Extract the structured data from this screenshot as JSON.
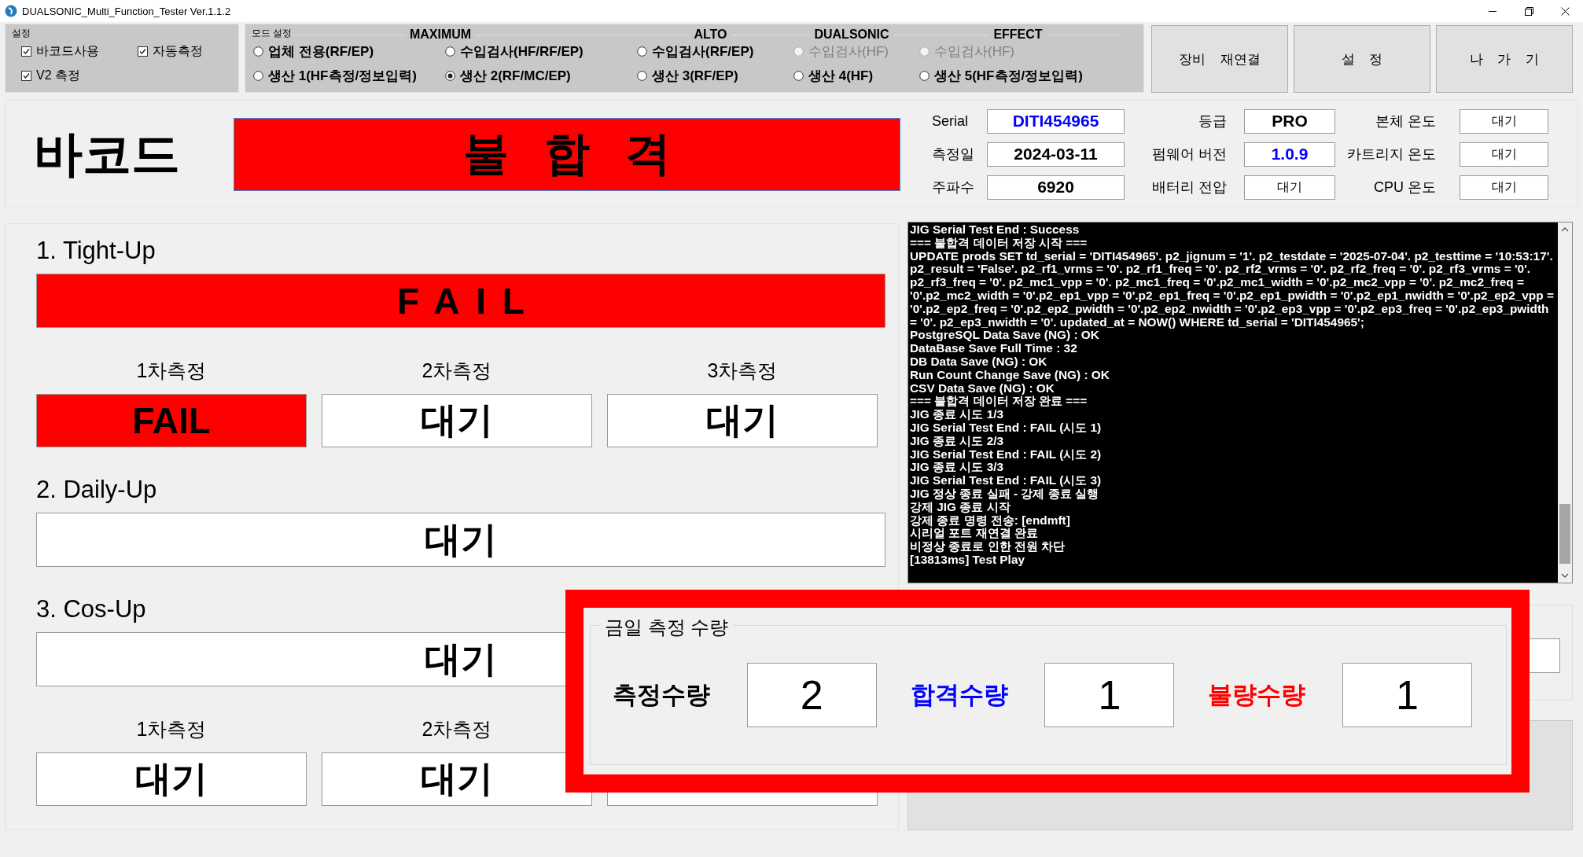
{
  "window": {
    "title": "DUALSONIC_Multi_Function_Tester Ver.1.1.2"
  },
  "settings": {
    "title": "설정",
    "checkboxes": [
      {
        "label": "바코드사용",
        "checked": true
      },
      {
        "label": "자동측정",
        "checked": true
      },
      {
        "label": "V2 측정",
        "checked": true
      }
    ]
  },
  "mode": {
    "title": "모드 설정",
    "groups": [
      {
        "title": "MAXIMUM",
        "columns": [
          [
            {
              "label": "업체 전용(RF/EP)",
              "selected": false,
              "disabled": false
            },
            {
              "label": "생산 1(HF측정/정보입력)",
              "selected": false,
              "disabled": false
            }
          ],
          [
            {
              "label": "수입검사(HF/RF/EP)",
              "selected": false,
              "disabled": false
            },
            {
              "label": "생산 2(RF/MC/EP)",
              "selected": true,
              "disabled": false
            }
          ]
        ]
      },
      {
        "title": "ALTO",
        "columns": [
          [
            {
              "label": "수입검사(RF/EP)",
              "selected": false,
              "disabled": false
            },
            {
              "label": "생산 3(RF/EP)",
              "selected": false,
              "disabled": false
            }
          ]
        ]
      },
      {
        "title": "DUALSONIC",
        "columns": [
          [
            {
              "label": "수입검사(HF)",
              "selected": false,
              "disabled": true
            },
            {
              "label": "생산 4(HF)",
              "selected": false,
              "disabled": false
            }
          ]
        ]
      },
      {
        "title": "EFFECT",
        "columns": [
          [
            {
              "label": "수입검사(HF)",
              "selected": false,
              "disabled": true
            },
            {
              "label": "생산 5(HF측정/정보입력)",
              "selected": false,
              "disabled": false
            }
          ]
        ]
      }
    ]
  },
  "buttons": [
    "장비 재연결",
    "설 정",
    "나 가 기"
  ],
  "barcode": {
    "label": "바코드",
    "result": "불 합 격",
    "failed": true
  },
  "info": [
    {
      "label": "Serial",
      "value": "DITI454965",
      "color": "#0000ff"
    },
    {
      "label": "등급",
      "value": "PRO",
      "color": "#000000"
    },
    {
      "label": "본체 온도",
      "value": "대기",
      "color": "#000000"
    },
    {
      "label": "측정일",
      "value": "2024-03-11",
      "color": "#000000"
    },
    {
      "label": "펌웨어 버전",
      "value": "1.0.9",
      "color": "#0000ff"
    },
    {
      "label": "카트리지 온도",
      "value": "대기",
      "color": "#000000"
    },
    {
      "label": "주파수",
      "value": "6920",
      "color": "#000000"
    },
    {
      "label": "배터리 전압",
      "value": "대기",
      "color": "#000000"
    },
    {
      "label": "CPU 온도",
      "value": "대기",
      "color": "#000000"
    }
  ],
  "tests": [
    {
      "title": "1. Tight-Up",
      "result": {
        "text": "FAIL",
        "failed": true
      },
      "rounds": [
        {
          "label": "1차측정",
          "text": "FAIL",
          "failed": true
        },
        {
          "label": "2차측정",
          "text": "대기",
          "failed": false
        },
        {
          "label": "3차측정",
          "text": "대기",
          "failed": false
        }
      ]
    },
    {
      "title": "2. Daily-Up",
      "result": {
        "text": "대기",
        "failed": false
      }
    },
    {
      "title": "3. Cos-Up",
      "result": {
        "text": "대기",
        "failed": false
      },
      "rounds": [
        {
          "label": "1차측정",
          "text": "대기",
          "failed": false
        },
        {
          "label": "2차측정",
          "text": "대기",
          "failed": false
        },
        {
          "failed": false
        }
      ]
    }
  ],
  "log": {
    "lines": [
      "JIG Serial Test End : Success",
      "=== 불합격 데이터 저장 시작 ===",
      "UPDATE prods SET td_serial = 'DITI454965'. p2_jignum = '1'. p2_testdate = '2025-07-04'. p2_testtime = '10:53:17'. p2_result = 'False'. p2_rf1_vrms = '0'. p2_rf1_freq = '0'. p2_rf2_vrms = '0'. p2_rf2_freq = '0'. p2_rf3_vrms = '0'. p2_rf3_freq = '0'. p2_mc1_vpp = '0'. p2_mc1_freq = '0'.p2_mc1_width = '0'.p2_mc2_vpp = '0'. p2_mc2_freq = '0'.p2_mc2_width = '0'.p2_ep1_vpp = '0'.p2_ep1_freq = '0'.p2_ep1_pwidth = '0'.p2_ep1_nwidth = '0'.p2_ep2_vpp = '0'.p2_ep2_freq = '0'.p2_ep2_pwidth = '0'.p2_ep2_nwidth = '0'.p2_ep3_vpp = '0'.p2_ep3_freq = '0'.p2_ep3_pwidth = '0'. p2_ep3_nwidth = '0'. updated_at = NOW() WHERE td_serial = 'DITI454965';",
      "PostgreSQL Data Save (NG) : OK",
      "DataBase Save Full Time : 32",
      "DB Data Save (NG) : OK",
      "Run Count Change Save (NG) : OK",
      "CSV Data Save (NG) : OK",
      "=== 불합격 데이터 저장 완료 ===",
      "JIG 종료 시도 1/3",
      "JIG Serial Test End : FAIL (시도 1)",
      "JIG 종료 시도 2/3",
      "JIG Serial Test End : FAIL (시도 2)",
      "JIG 종료 시도 3/3",
      "JIG Serial Test End : FAIL (시도 3)",
      "JIG 정상 종료 실패 - 강제 종료 실행",
      "강제 JIG 종료 시작",
      "강제 종료 명령 전송: [endmft]",
      "시리얼 포트 재연결 완료",
      "비정상 종료로 인한 전원 차단",
      "[13813ms] Test Play"
    ]
  },
  "daily_count": {
    "title": "금일 측정 수량",
    "items": [
      {
        "label": "측정수량",
        "value": "2",
        "color": "#000000"
      },
      {
        "label": "합격수량",
        "value": "1",
        "color": "#0000ff"
      },
      {
        "label": "불량수량",
        "value": "1",
        "color": "#ff0000"
      }
    ]
  }
}
